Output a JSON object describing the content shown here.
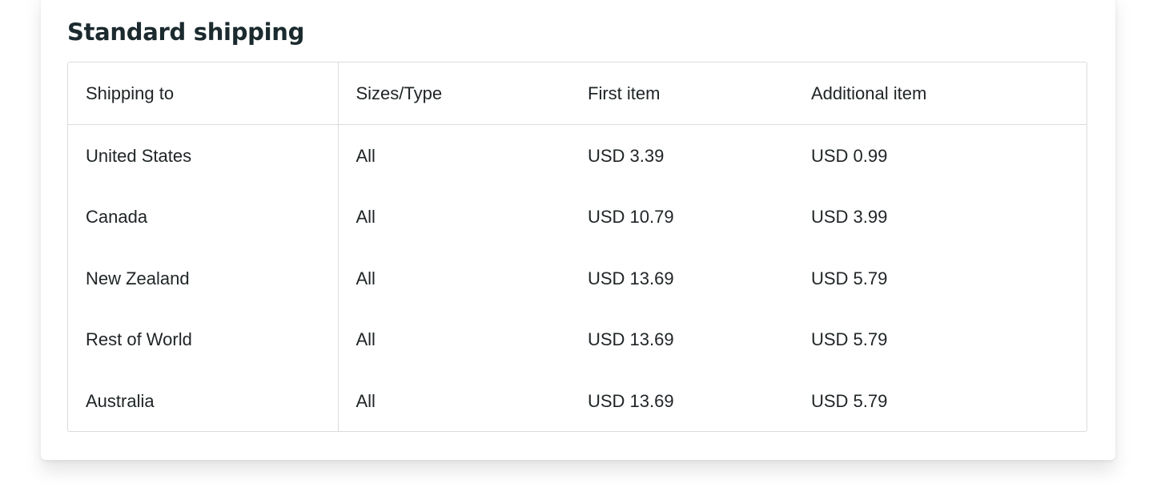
{
  "section": {
    "title": "Standard shipping"
  },
  "table": {
    "headers": [
      "Shipping to",
      "Sizes/Type",
      "First item",
      "Additional item"
    ],
    "rows": [
      {
        "destination": "United States",
        "type": "All",
        "first": "USD 3.39",
        "additional": "USD 0.99"
      },
      {
        "destination": "Canada",
        "type": "All",
        "first": "USD 10.79",
        "additional": "USD 3.99"
      },
      {
        "destination": "New Zealand",
        "type": "All",
        "first": "USD 13.69",
        "additional": "USD 5.79"
      },
      {
        "destination": "Rest of World",
        "type": "All",
        "first": "USD 13.69",
        "additional": "USD 5.79"
      },
      {
        "destination": "Australia",
        "type": "All",
        "first": "USD 13.69",
        "additional": "USD 5.79"
      }
    ]
  }
}
